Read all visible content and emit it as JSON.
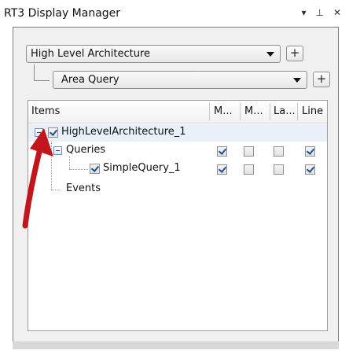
{
  "window": {
    "title": "RT3 Display Manager",
    "icons": [
      "dropdown-arrow-icon",
      "pin-icon",
      "close-icon"
    ]
  },
  "architecture_combo": {
    "selected": "High Level Architecture"
  },
  "query_combo": {
    "selected": "Area Query"
  },
  "add_button_label": "+",
  "tree": {
    "columns": [
      "Items",
      "M...",
      "M...",
      "La...",
      "Line"
    ],
    "rows": [
      {
        "label": "HighLevelArchitecture_1",
        "checked": true
      },
      {
        "label": "Queries",
        "cols": [
          true,
          false,
          false,
          true
        ]
      },
      {
        "label": "SimpleQuery_1",
        "checked": true,
        "cols": [
          true,
          false,
          false,
          true
        ]
      },
      {
        "label": "Events"
      }
    ]
  },
  "colors": {
    "annotation_arrow": "#c3161c",
    "checkmark": "#1d4e8f"
  }
}
